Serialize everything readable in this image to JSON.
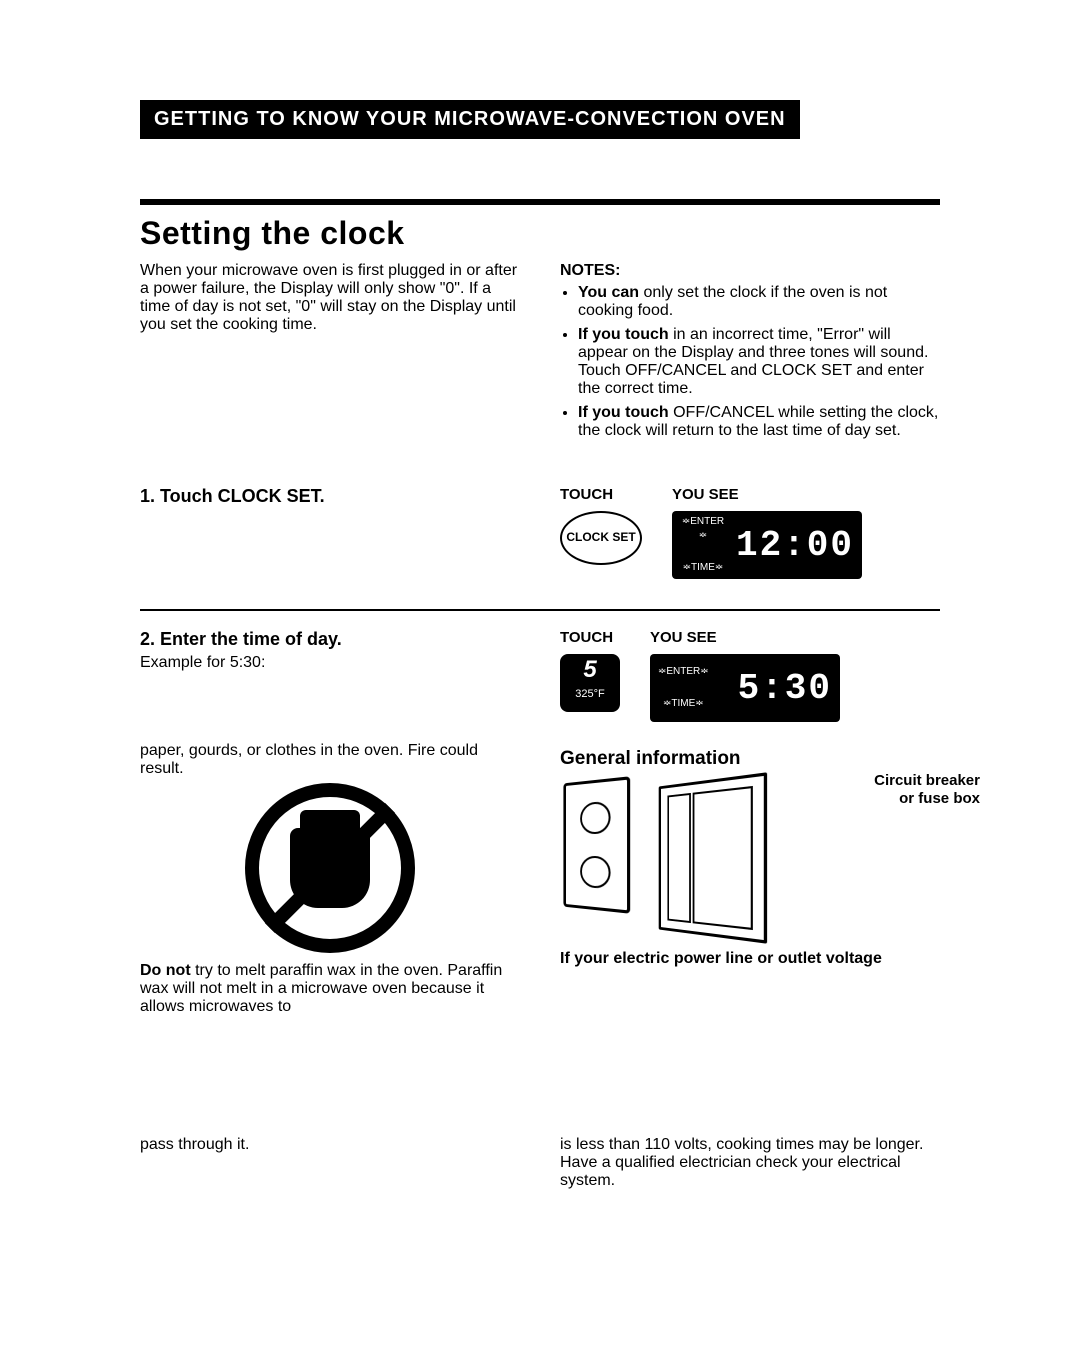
{
  "header": "GETTING TO KNOW YOUR MICROWAVE-CONVECTION OVEN",
  "section_title": "Setting the clock",
  "intro": "When your microwave oven is first plugged in or after a power failure, the Display will only show \"0\". If a time of day is not set, \"0\" will stay on the Display until you set the cooking time.",
  "notes_label": "NOTES:",
  "notes": {
    "n1_bold": "You can",
    "n1_rest": " only set the clock if the oven is not cooking food.",
    "n2_bold": "If you touch",
    "n2_rest": " in an incorrect time, \"Error\" will appear on the Display and three tones will sound. Touch OFF/CANCEL and CLOCK SET and enter the correct time.",
    "n3_bold": "If you touch",
    "n3_rest": " OFF/CANCEL while setting the clock, the clock will return to the last time of day set."
  },
  "step1": {
    "head": "1. Touch CLOCK SET.",
    "touch_label": "TOUCH",
    "see_label": "YOU SEE",
    "button_text": "CLOCK SET",
    "display_indicator_top": "ENTER",
    "display_indicator_bottom": "TIME",
    "display_digits": "12:00"
  },
  "step2": {
    "head": "2. Enter the time of day.",
    "sub": "Example for 5:30:",
    "touch_label": "TOUCH",
    "see_label": "YOU SEE",
    "key_big": "5",
    "key_small": "325°F",
    "display_indicator_top": "ENTER",
    "display_indicator_bottom": "TIME",
    "display_digits": "5:30"
  },
  "frag_left_top": "paper, gourds, or clothes in the oven. Fire could result.",
  "paraffin_bold": "Do not",
  "paraffin_rest": " try to melt paraffin wax in the oven. Paraffin wax will not melt in a microwave oven because it allows microwaves to",
  "frag_left_bottom": "pass through it.",
  "general_info": "General information",
  "circuit_label": "Circuit breaker or fuse box",
  "power_line": "If your electric power line or outlet voltage",
  "power_rest": "is less than 110 volts, cooking times may be longer. Have a qualified electrician check your electrical system."
}
